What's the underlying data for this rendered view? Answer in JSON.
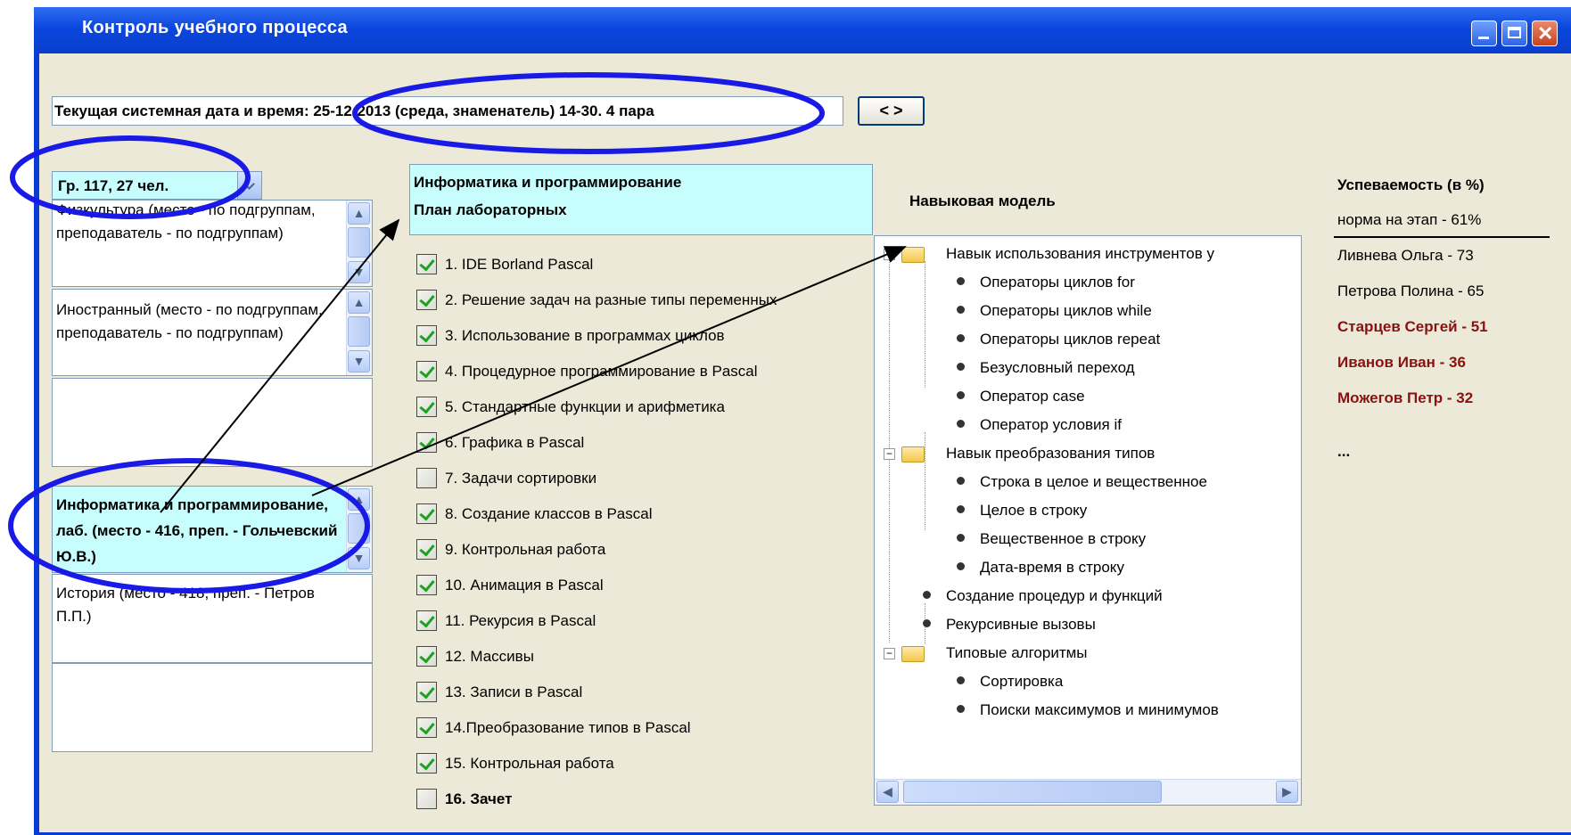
{
  "window": {
    "title": "Контроль учебного процесса"
  },
  "datetime": {
    "label": "Текущая системная дата и время: 25-12-2013 (среда, знаменатель) 14-30.  4 пара",
    "nav_label": "< >"
  },
  "group": {
    "selected": "Гр. 117, 27 чел."
  },
  "schedule": {
    "items": [
      "Физкультура (место - по подгруппам, преподаватель - по подгруппам)",
      "Иностранный (место - по подгруппам, преподаватель - по подгруппам)",
      "",
      "Информатика и программирование, лаб. (место - 416, преп. - Гольчевский Ю.В.)",
      "История (место - 418, преп. - Петров П.П.)",
      ""
    ]
  },
  "plan": {
    "subject": "Информатика и программирование",
    "subtitle": "План лабораторных",
    "labs": [
      {
        "label": "1. IDE Borland Pascal",
        "checked": true
      },
      {
        "label": "2. Решение задач на разные типы переменных",
        "checked": true
      },
      {
        "label": "3. Использование в программах циклов",
        "checked": true
      },
      {
        "label": "4. Процедурное программирование в Pascal",
        "checked": true
      },
      {
        "label": "5. Стандартные функции и арифметика",
        "checked": true
      },
      {
        "label": "6. Графика в Pascal",
        "checked": true
      },
      {
        "label": "7. Задачи сортировки",
        "checked": false
      },
      {
        "label": "8. Создание классов в Pascal",
        "checked": true
      },
      {
        "label": "9. Контрольная работа",
        "checked": true
      },
      {
        "label": "10. Анимация в Pascal",
        "checked": true
      },
      {
        "label": "11. Рекурсия в Pascal",
        "checked": true
      },
      {
        "label": "12. Массивы",
        "checked": true
      },
      {
        "label": "13. Записи в Pascal",
        "checked": true
      },
      {
        "label": "14.Преобразование типов в Pascal",
        "checked": true
      },
      {
        "label": "15. Контрольная работа",
        "checked": true
      },
      {
        "label": "16. Зачет",
        "checked": false
      }
    ]
  },
  "skills": {
    "title": "Навыковая модель",
    "nodes": [
      "Навык использования инструментов у",
      "Операторы циклов for",
      "Операторы циклов while",
      "Операторы циклов repeat",
      "Безусловный переход",
      "Оператор case",
      "Оператор условия if",
      "Навык преобразования типов",
      "Строка в целое и вещественное",
      "Целое в строку",
      "Вещественное в строку",
      "Дата-время в строку",
      "Создание процедур и функций",
      "Рекурсивные вызовы",
      "Типовые алгоритмы",
      "Сортировка",
      "Поиски максимумов и минимумов"
    ]
  },
  "progress": {
    "title": "Успеваемость (в %)",
    "norm": "норма на этап - 61%",
    "students": [
      {
        "text": "Ливнева Ольга - 73",
        "below_norm": false
      },
      {
        "text": "Петрова Полина - 65",
        "below_norm": false
      },
      {
        "text": "Старцев Сергей - 51",
        "below_norm": true
      },
      {
        "text": "Иванов Иван - 36",
        "below_norm": true
      },
      {
        "text": "Можегов Петр - 32",
        "below_norm": true
      }
    ],
    "more": "..."
  },
  "colors": {
    "titlebar": "#0a46dd",
    "highlight": "#c8fdfd",
    "annotation": "#1a1ae6",
    "below_norm": "#8b1111"
  }
}
